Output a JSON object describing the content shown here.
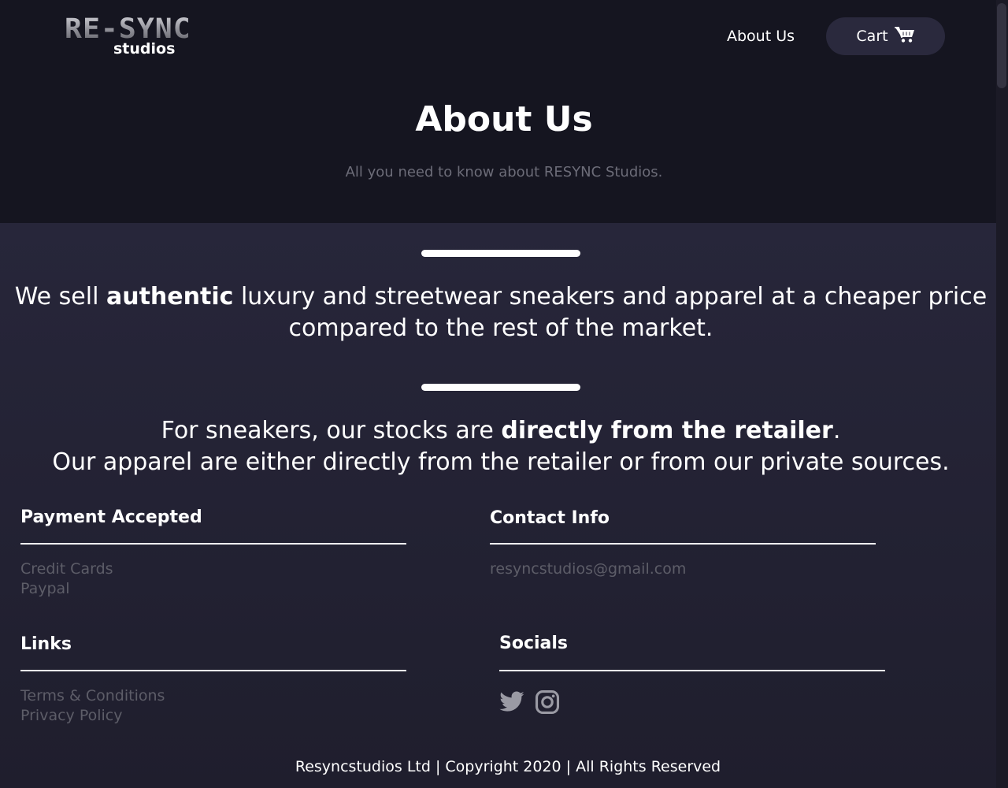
{
  "brand": {
    "logo_main": "RE-SYNC",
    "logo_sub": "studios"
  },
  "nav": {
    "about_label": "About Us",
    "cart_label": "Cart",
    "cart_icon": "cart-icon"
  },
  "hero": {
    "title": "About Us",
    "subtitle": "All you need to know about RESYNC Studios."
  },
  "statements": {
    "first": {
      "part1": "We sell ",
      "bold": "authentic",
      "part2": " luxury and streetwear sneakers and apparel at a cheaper price compared to the rest of the market."
    },
    "second": {
      "part1": "For sneakers, our stocks are ",
      "bold": "directly from the retailer",
      "part2": ".",
      "line2": "Our apparel are either directly from the retailer or from our private sources."
    }
  },
  "footer": {
    "payment": {
      "title": "Payment Accepted",
      "items": [
        "Credit Cards",
        "Paypal"
      ]
    },
    "contact": {
      "title": "Contact Info",
      "email": "resyncstudios@gmail.com"
    },
    "links": {
      "title": "Links",
      "items": [
        "Terms & Conditions",
        "Privacy Policy"
      ]
    },
    "socials": {
      "title": "Socials",
      "icons": [
        "twitter-icon",
        "instagram-icon"
      ]
    },
    "copyright": "Resyncstudios Ltd | Copyright 2020 | All Rights Reserved"
  },
  "colors": {
    "header_bg": "#151520",
    "main_bg": "#27263a",
    "button_bg": "#2a293d",
    "muted_text": "#5d5d68"
  }
}
